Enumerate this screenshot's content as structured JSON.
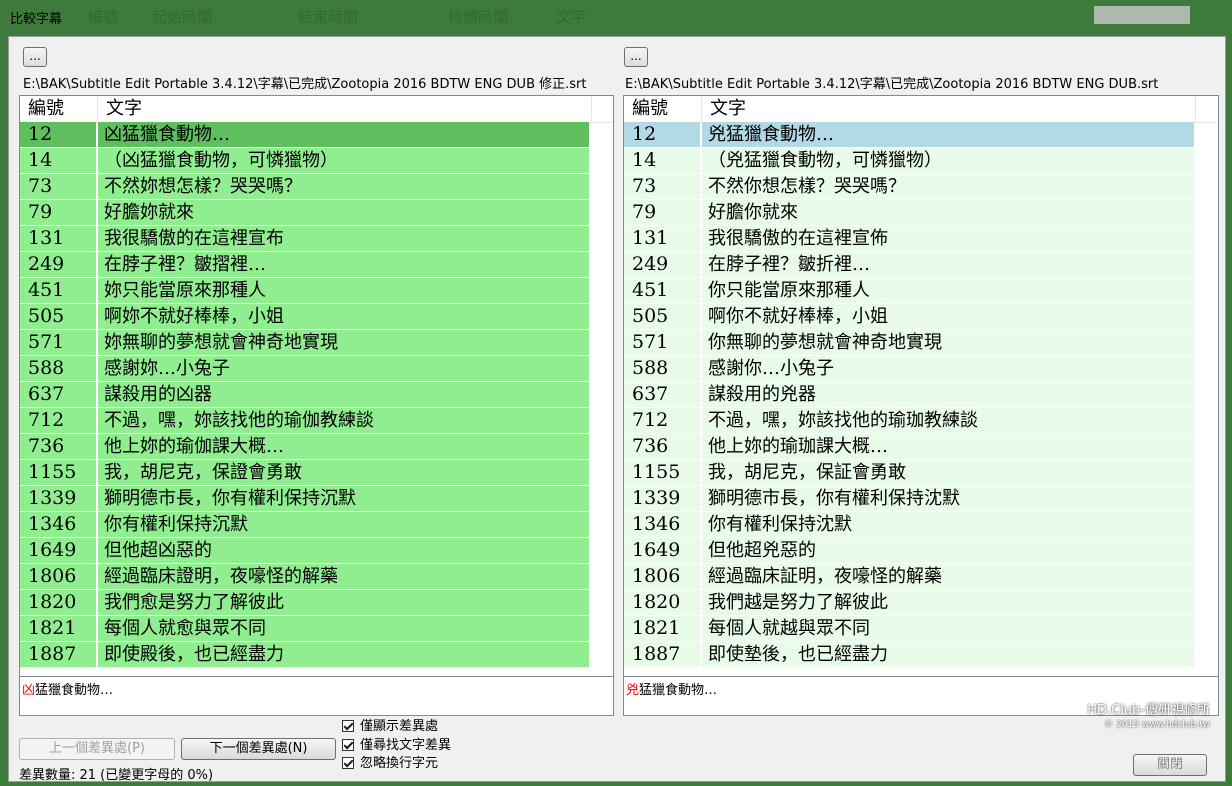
{
  "window": {
    "title": "比較字幕",
    "bg_header_fragments": [
      "編號",
      "起始時間",
      "結束時間",
      "持續時間",
      "文字"
    ]
  },
  "left": {
    "browse_label": "...",
    "file_path": "E:\\BAK\\Subtitle Edit Portable 3.4.12\\字幕\\已完成\\Zootopia 2016 BDTW ENG DUB 修正.srt",
    "columns": [
      "編號",
      "文字"
    ],
    "rows": [
      {
        "num": "12",
        "text": "凶猛獵食動物…"
      },
      {
        "num": "14",
        "text": "（凶猛獵食動物，可憐獵物）"
      },
      {
        "num": "73",
        "text": "不然妳想怎樣？哭哭嗎？"
      },
      {
        "num": "79",
        "text": "好膽妳就來"
      },
      {
        "num": "131",
        "text": "我很驕傲的在這裡宣布"
      },
      {
        "num": "249",
        "text": "在脖子裡？皺摺裡…"
      },
      {
        "num": "451",
        "text": "妳只能當原來那種人"
      },
      {
        "num": "505",
        "text": "啊妳不就好棒棒，小姐"
      },
      {
        "num": "571",
        "text": "妳無聊的夢想就會神奇地實現"
      },
      {
        "num": "588",
        "text": "感謝妳…小兔子"
      },
      {
        "num": "637",
        "text": "謀殺用的凶器"
      },
      {
        "num": "712",
        "text": "不過，嘿，妳該找他的瑜伽教練談"
      },
      {
        "num": "736",
        "text": "他上妳的瑜伽課大概…"
      },
      {
        "num": "1155",
        "text": "我，胡尼克，保證會勇敢"
      },
      {
        "num": "1339",
        "text": "獅明德市長，你有權利保持沉默"
      },
      {
        "num": "1346",
        "text": "你有權利保持沉默"
      },
      {
        "num": "1649",
        "text": "但他超凶惡的"
      },
      {
        "num": "1806",
        "text": "經過臨床證明，夜嚎怪的解藥"
      },
      {
        "num": "1820",
        "text": "我們愈是努力了解彼此"
      },
      {
        "num": "1821",
        "text": "每個人就愈與眾不同"
      },
      {
        "num": "1887",
        "text": "即使殿後，也已經盡力"
      }
    ],
    "detail_diff_char": "凶",
    "detail_rest": "猛獵食動物…"
  },
  "right": {
    "browse_label": "...",
    "file_path": "E:\\BAK\\Subtitle Edit Portable 3.4.12\\字幕\\已完成\\Zootopia 2016 BDTW ENG DUB.srt",
    "columns": [
      "編號",
      "文字"
    ],
    "rows": [
      {
        "num": "12",
        "text": "兇猛獵食動物…"
      },
      {
        "num": "14",
        "text": "（兇猛獵食動物，可憐獵物）"
      },
      {
        "num": "73",
        "text": "不然你想怎樣？哭哭嗎？"
      },
      {
        "num": "79",
        "text": "好膽你就來"
      },
      {
        "num": "131",
        "text": "我很驕傲的在這裡宣佈"
      },
      {
        "num": "249",
        "text": "在脖子裡？皺折裡…"
      },
      {
        "num": "451",
        "text": "你只能當原來那種人"
      },
      {
        "num": "505",
        "text": "啊你不就好棒棒，小姐"
      },
      {
        "num": "571",
        "text": "你無聊的夢想就會神奇地實現"
      },
      {
        "num": "588",
        "text": "感謝你…小兔子"
      },
      {
        "num": "637",
        "text": "謀殺用的兇器"
      },
      {
        "num": "712",
        "text": "不過，嘿，妳該找他的瑜珈教練談"
      },
      {
        "num": "736",
        "text": "他上妳的瑜珈課大概…"
      },
      {
        "num": "1155",
        "text": "我，胡尼克，保証會勇敢"
      },
      {
        "num": "1339",
        "text": "獅明德市長，你有權利保持沈默"
      },
      {
        "num": "1346",
        "text": "你有權利保持沈默"
      },
      {
        "num": "1649",
        "text": "但他超兇惡的"
      },
      {
        "num": "1806",
        "text": "經過臨床証明，夜嚎怪的解藥"
      },
      {
        "num": "1820",
        "text": "我們越是努力了解彼此"
      },
      {
        "num": "1821",
        "text": "每個人就越與眾不同"
      },
      {
        "num": "1887",
        "text": "即使墊後，也已經盡力"
      }
    ],
    "detail_diff_char": "兇",
    "detail_rest": "猛獵食動物…"
  },
  "controls": {
    "prev_diff": "上一個差異處(P)",
    "next_diff": "下一個差異處(N)",
    "only_show_diffs": "僅顯示差異處",
    "only_text_diffs": "僅尋找文字差異",
    "ignore_linebreaks": "忽略換行字元",
    "status": "差異數量: 21 (已變更字母的 0%)",
    "close_label": "關閉"
  },
  "watermark": {
    "line1": "HD.Club-傳研視修所",
    "line2": "© 2015  www.hdclub.tw"
  },
  "colors": {
    "left_selected": "#5fbf5f",
    "left_row": "#90ee90",
    "right_selected": "#b3d9e6",
    "right_row": "#e8fbe8"
  }
}
